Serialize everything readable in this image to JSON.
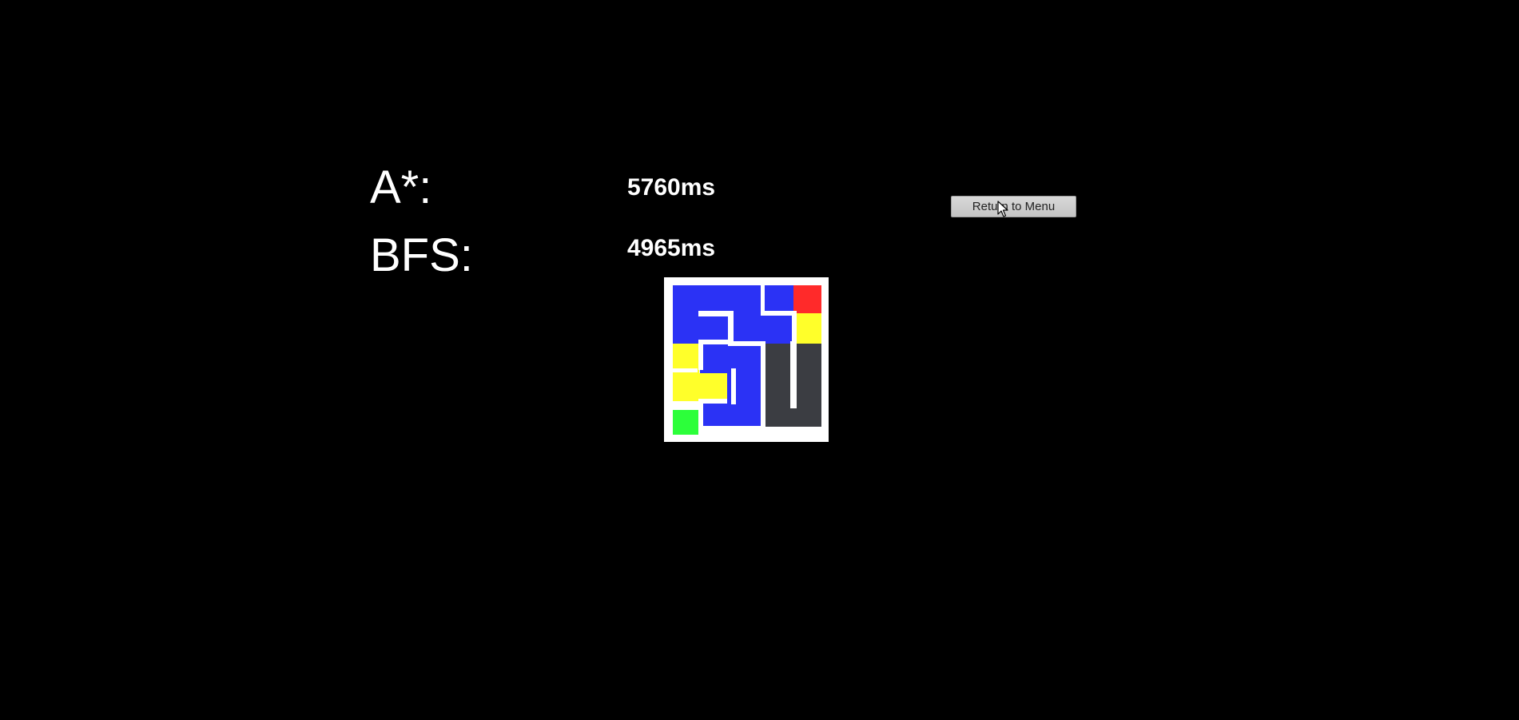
{
  "results": {
    "astar": {
      "label": "A*:",
      "time": "5760ms"
    },
    "bfs": {
      "label": "BFS:",
      "time": "4965ms"
    }
  },
  "return_button": {
    "label": "Return to Menu"
  },
  "maze": {
    "colors": {
      "frame": "#ffffff",
      "visited": "#2b32f5",
      "path": "#ffff2a",
      "start": "#2cff3a",
      "goal": "#ff2a2a",
      "unexplored": "#3b3d42",
      "wall": "#ffffff"
    }
  }
}
